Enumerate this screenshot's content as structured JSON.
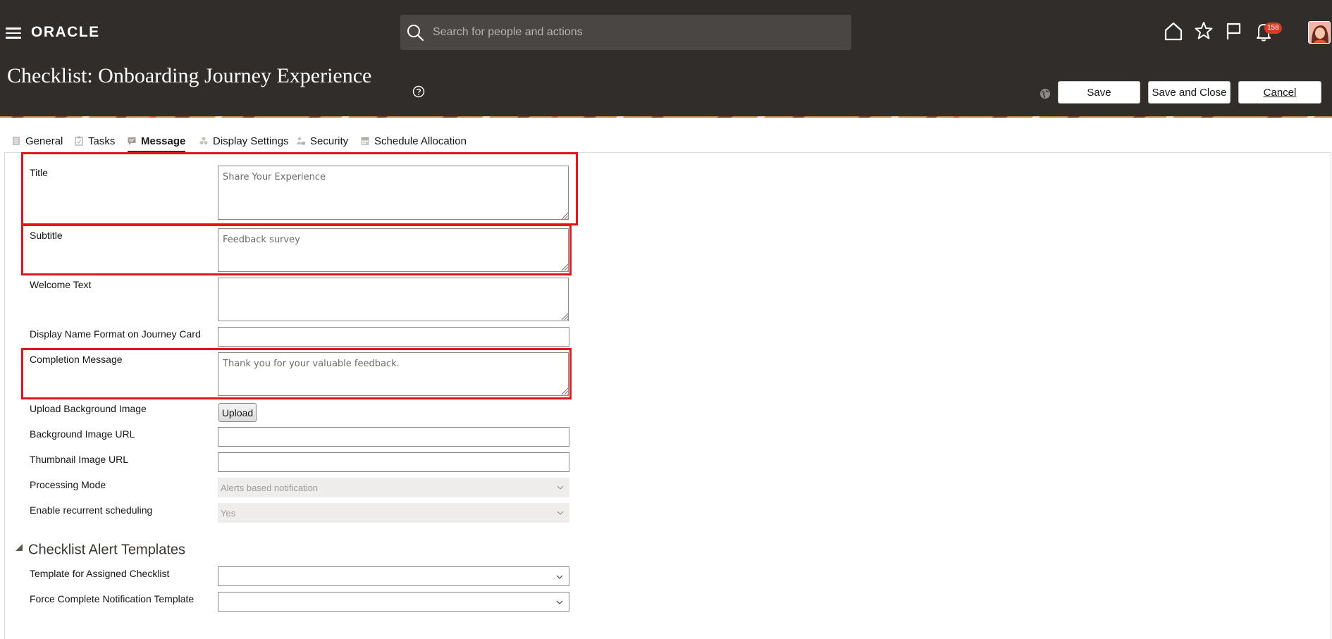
{
  "header": {
    "logo": "ORACLE",
    "search_placeholder": "Search for people and actions",
    "notification_count": "158",
    "page_title": "Checklist: Onboarding Journey Experience",
    "buttons": {
      "save": "Save",
      "save_close": "Save and Close",
      "cancel": "Cancel"
    }
  },
  "tabs": [
    {
      "label": "General",
      "icon": "document-icon"
    },
    {
      "label": "Tasks",
      "icon": "clipboard-icon"
    },
    {
      "label": "Message",
      "icon": "speech-bubble-icon",
      "active": true
    },
    {
      "label": "Display Settings",
      "icon": "circles-icon"
    },
    {
      "label": "Security",
      "icon": "people-lock-icon"
    },
    {
      "label": "Schedule Allocation",
      "icon": "calendar-icon"
    }
  ],
  "form": {
    "title_label": "Title",
    "title_value": "Share Your Experience",
    "subtitle_label": "Subtitle",
    "subtitle_value": "Feedback survey",
    "welcome_label": "Welcome Text",
    "welcome_value": "",
    "display_name_label": "Display Name Format on Journey Card",
    "completion_label": "Completion Message",
    "completion_value": "Thank you for your valuable feedback.",
    "upload_label": "Upload Background Image",
    "upload_button": "Upload",
    "bg_url_label": "Background Image URL",
    "thumb_url_label": "Thumbnail Image URL",
    "processing_label": "Processing Mode",
    "processing_value": "Alerts based notification",
    "recurrent_label": "Enable recurrent scheduling",
    "recurrent_value": "Yes"
  },
  "alerts_section": {
    "title": "Checklist Alert Templates",
    "assigned_label": "Template for Assigned Checklist",
    "force_label": "Force Complete Notification Template"
  },
  "colors": {
    "header_bg": "#312d2a",
    "highlight": "#e3141c",
    "badge": "#d63b25"
  }
}
